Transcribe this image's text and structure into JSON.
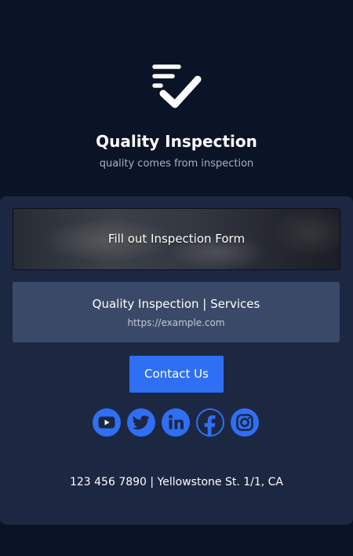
{
  "header": {
    "logo_icon": "checklist-icon",
    "title": "Quality Inspection",
    "subtitle": "quality comes from inspection"
  },
  "links": {
    "form_label": "Fill out Inspection Form",
    "services_title": "Quality Inspection | Services",
    "services_url": "https://example.com"
  },
  "contact": {
    "label": "Contact Us"
  },
  "social": {
    "icons": [
      "youtube-icon",
      "twitter-icon",
      "linkedin-icon",
      "facebook-icon",
      "instagram-icon"
    ]
  },
  "footer": {
    "address": "123 456 7890 | Yellowstone St. 1/1, CA"
  },
  "colors": {
    "page_background": "#0b1426",
    "card_background": "#1c2742",
    "link_background": "#3a4968",
    "accent": "#2f6ff3"
  }
}
